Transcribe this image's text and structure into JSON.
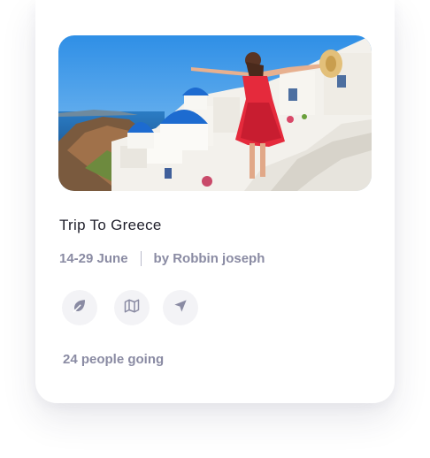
{
  "trip": {
    "title": "Trip To Greece",
    "dates": "14-29 June",
    "author": "by Robbin joseph",
    "attendance": "24 people going"
  },
  "actions": [
    {
      "icon": "leaf-icon"
    },
    {
      "icon": "map-icon"
    },
    {
      "icon": "navigation-arrow-icon"
    }
  ],
  "colors": {
    "text_dark": "#1f1f2b",
    "text_muted": "#8a8ba3",
    "icon_bg": "#f3f3f6",
    "dress_red": "#e52a3c",
    "dome_blue": "#1d6bd0"
  }
}
